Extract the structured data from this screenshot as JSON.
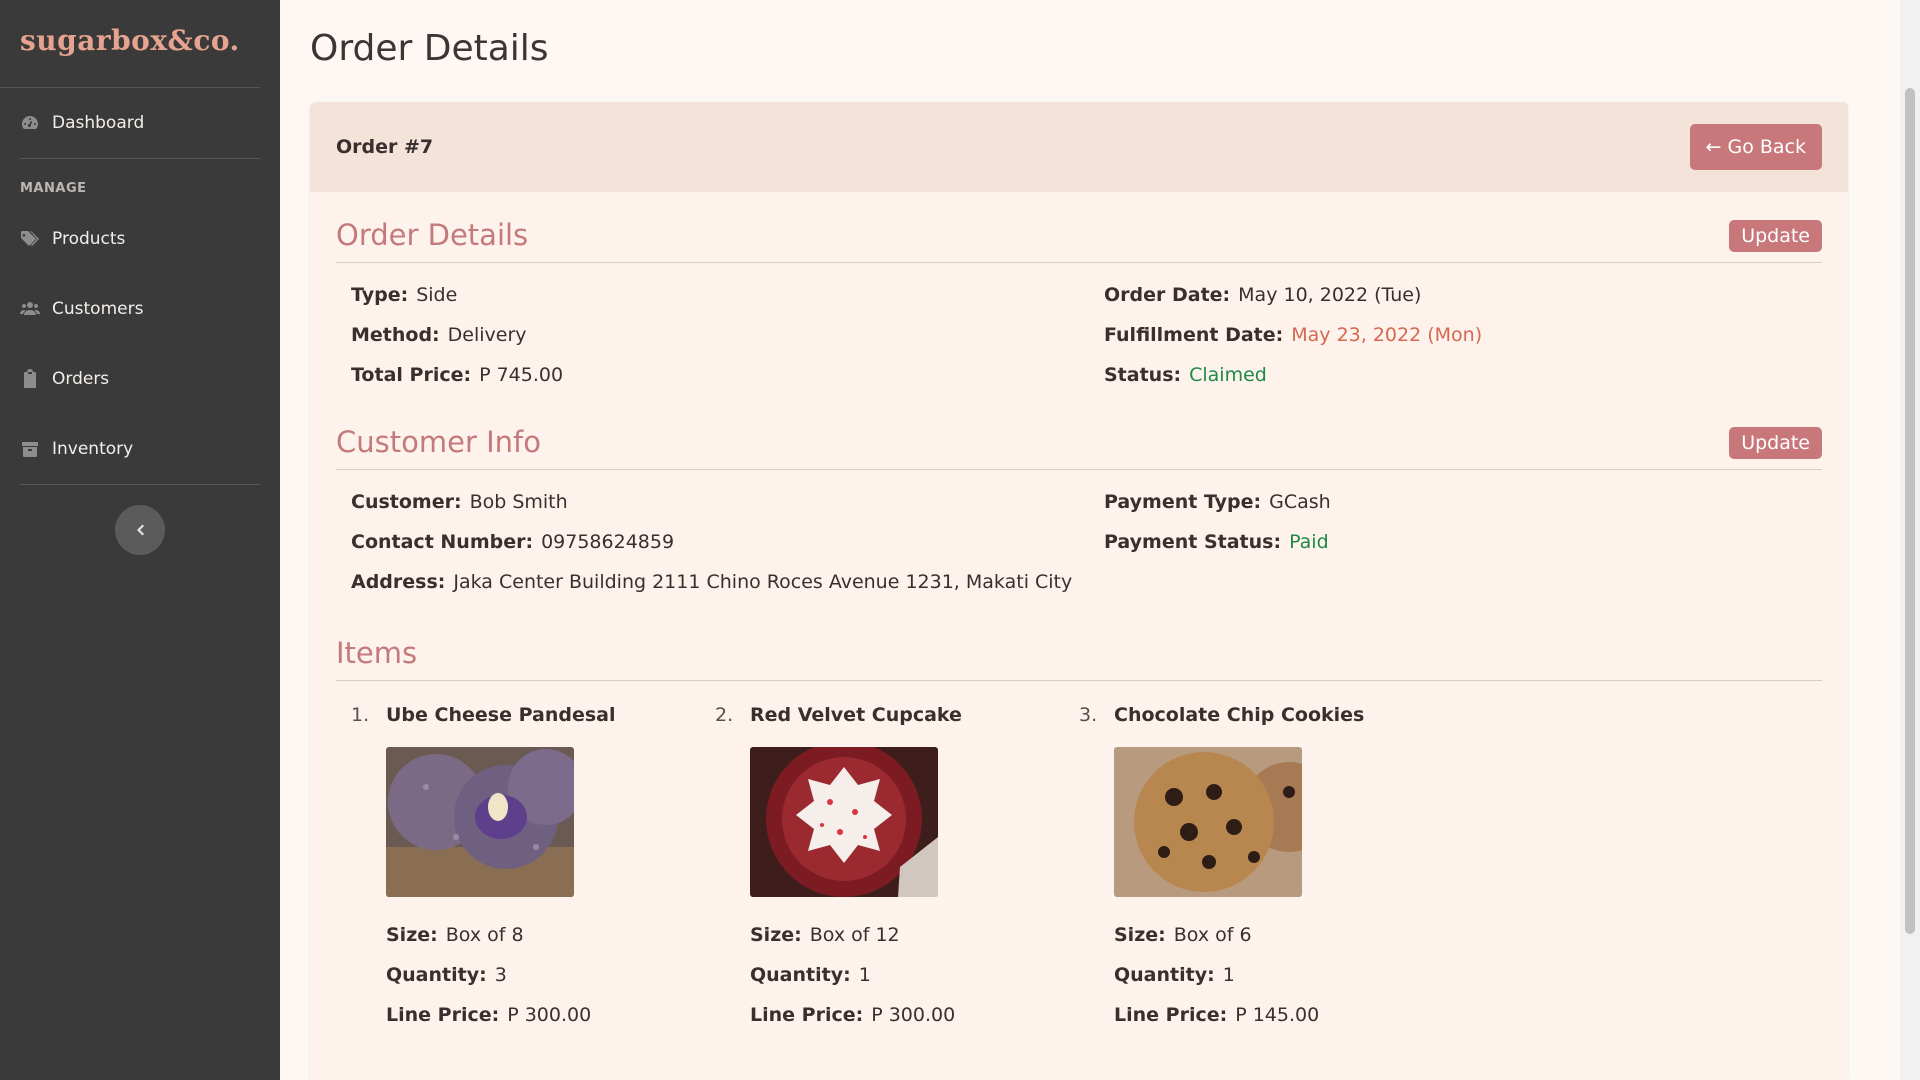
{
  "sidebar": {
    "brand": "sugarbox&co.",
    "items": [
      {
        "label": "Dashboard",
        "icon": "gauge-icon"
      },
      {
        "label": "Products",
        "icon": "tags-icon"
      },
      {
        "label": "Customers",
        "icon": "users-icon"
      },
      {
        "label": "Orders",
        "icon": "clipboard-icon"
      },
      {
        "label": "Inventory",
        "icon": "box-icon"
      }
    ],
    "section_label": "MANAGE"
  },
  "page": {
    "title": "Order Details"
  },
  "order": {
    "header": "Order #7",
    "back_label": "← Go Back"
  },
  "order_details": {
    "heading": "Order Details",
    "update_label": "Update",
    "type_label": "Type:",
    "type": "Side",
    "method_label": "Method:",
    "method": "Delivery",
    "total_label": "Total Price:",
    "total": "P 745.00",
    "order_date_label": "Order Date:",
    "order_date": "May 10, 2022 (Tue)",
    "fulfillment_label": "Fulfillment Date:",
    "fulfillment_date": "May 23, 2022 (Mon)",
    "status_label": "Status:",
    "status": "Claimed"
  },
  "customer_info": {
    "heading": "Customer Info",
    "update_label": "Update",
    "customer_label": "Customer:",
    "customer": "Bob Smith",
    "contact_label": "Contact Number:",
    "contact": "09758624859",
    "address_label": "Address:",
    "address": "Jaka Center Building 2111 Chino Roces Avenue 1231, Makati City",
    "payment_type_label": "Payment Type:",
    "payment_type": "GCash",
    "payment_status_label": "Payment Status:",
    "payment_status": "Paid"
  },
  "items": {
    "heading": "Items",
    "size_label": "Size:",
    "quantity_label": "Quantity:",
    "line_price_label": "Line Price:",
    "list": [
      {
        "index": "1.",
        "name": "Ube Cheese Pandesal",
        "size": "Box of 8",
        "quantity": "3",
        "line_price": "P 300.00"
      },
      {
        "index": "2.",
        "name": "Red Velvet Cupcake",
        "size": "Box of 12",
        "quantity": "1",
        "line_price": "P 300.00"
      },
      {
        "index": "3.",
        "name": "Chocolate Chip Cookies",
        "size": "Box of 6",
        "quantity": "1",
        "line_price": "P 145.00"
      }
    ]
  },
  "colors": {
    "accent": "#c8787a",
    "sidebar_bg": "#3a3a3a",
    "highlight_orange": "#d5684f",
    "highlight_green": "#1e8a45"
  }
}
